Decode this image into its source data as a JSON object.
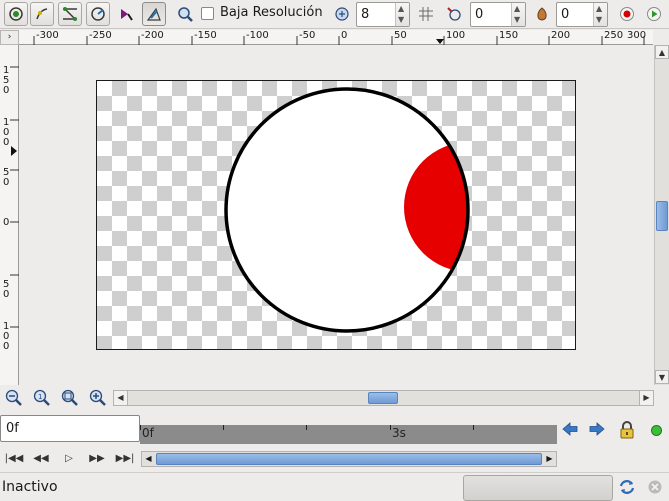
{
  "toolbar": {
    "low_res_label": "Baja Resolución",
    "grid_size": "8",
    "onion_past": "0",
    "onion_future": "0",
    "colors": {
      "record": "#d40000",
      "play": "#2a9a2a"
    }
  },
  "ruler": {
    "corner": "›",
    "top_labels": [
      "-300",
      "-250",
      "-200",
      "-150",
      "-100",
      "-50",
      "0",
      "50",
      "100",
      "150",
      "200",
      "250",
      "300"
    ],
    "left_labels": [
      "1",
      "5",
      "0",
      "1",
      "0",
      "0",
      "5",
      "0",
      "0",
      "5",
      "0",
      "1",
      "0",
      "0"
    ]
  },
  "canvas": {
    "colors": {
      "circle_fill": "#ffffff",
      "circle_stroke": "#000000",
      "region_fill": "#e60000"
    }
  },
  "timebar": {
    "current_time": "0f",
    "start_label": "0f",
    "mark_label": "3s"
  },
  "status": {
    "text": "Inactivo"
  }
}
